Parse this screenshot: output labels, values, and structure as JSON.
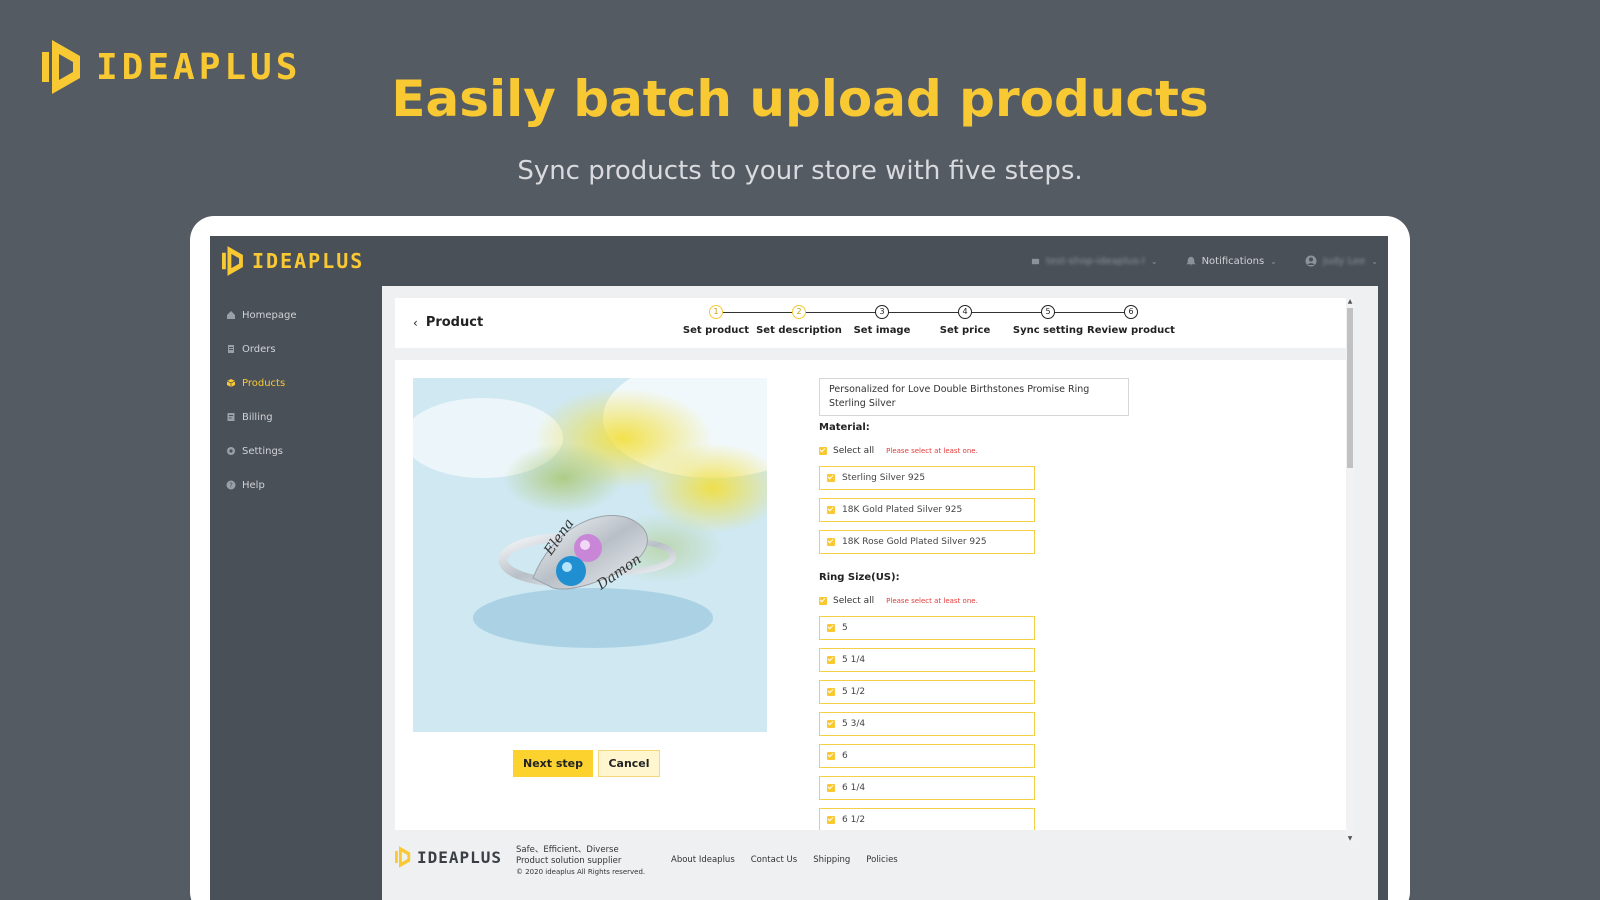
{
  "brand": {
    "name": "IDEAPLUS",
    "accent": "#f9c934"
  },
  "hero": {
    "title": "Easily batch upload products",
    "subtitle": "Sync products to your store with five steps."
  },
  "topbar": {
    "store_name": "test-shop-ideaplus-l",
    "notifications_label": "Notifications",
    "user_name": "Judy Lee"
  },
  "sidebar": {
    "items": [
      {
        "label": "Homepage",
        "icon": "home-icon"
      },
      {
        "label": "Orders",
        "icon": "orders-icon"
      },
      {
        "label": "Products",
        "icon": "products-icon",
        "active": true
      },
      {
        "label": "Billing",
        "icon": "billing-icon"
      },
      {
        "label": "Settings",
        "icon": "gear-icon"
      },
      {
        "label": "Help",
        "icon": "help-icon"
      }
    ]
  },
  "page": {
    "back_title": "Product",
    "steps": [
      {
        "num": "1",
        "label": "Set product",
        "done": true
      },
      {
        "num": "2",
        "label": "Set description",
        "done": true
      },
      {
        "num": "3",
        "label": "Set image",
        "done": false
      },
      {
        "num": "4",
        "label": "Set price",
        "done": false
      },
      {
        "num": "5",
        "label": "Sync setting",
        "done": false
      },
      {
        "num": "6",
        "label": "Review product",
        "done": false
      }
    ]
  },
  "product": {
    "title": "Personalized for Love Double Birthstones Promise Ring Sterling Silver",
    "ring_names": [
      "Elena",
      "Damon"
    ],
    "material_label": "Material:",
    "select_all": "Select all",
    "warning": "Please select at least one.",
    "materials": [
      "Sterling Silver 925",
      "18K Gold Plated Silver 925",
      "18K Rose Gold Plated Silver 925"
    ],
    "size_label": "Ring Size(US):",
    "sizes": [
      "5",
      "5 1/4",
      "5 1/2",
      "5 3/4",
      "6",
      "6 1/4",
      "6 1/2"
    ]
  },
  "actions": {
    "next": "Next step",
    "cancel": "Cancel"
  },
  "footer": {
    "tagline1": "Safe、Efficient、Diverse",
    "tagline2": "Product solution supplier",
    "copyright": "© 2020 ideaplus All Rights reserved.",
    "links": [
      "About Ideaplus",
      "Contact Us",
      "Shipping",
      "Policies"
    ]
  }
}
